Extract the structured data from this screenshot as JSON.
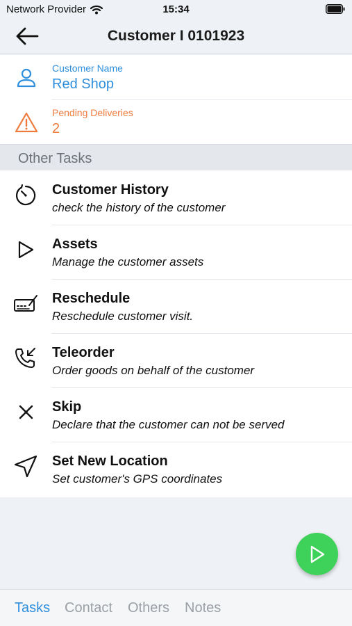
{
  "status_bar": {
    "carrier": "Network Provider",
    "time": "15:34"
  },
  "header": {
    "title": "Customer I 0101923"
  },
  "customer": {
    "name_label": "Customer Name",
    "name_value": "Red Shop",
    "deliveries_label": "Pending Deliveries",
    "deliveries_value": "2"
  },
  "section": {
    "title": "Other Tasks"
  },
  "tasks": [
    {
      "title": "Customer History",
      "subtitle": "check the history of the customer",
      "icon": "history-timer-icon"
    },
    {
      "title": "Assets",
      "subtitle": "Manage the customer assets",
      "icon": "play-outline-icon"
    },
    {
      "title": "Reschedule",
      "subtitle": "Reschedule customer visit.",
      "icon": "reschedule-signature-icon"
    },
    {
      "title": "Teleorder",
      "subtitle": "Order goods on behalf of the customer",
      "icon": "phone-incoming-icon"
    },
    {
      "title": "Skip",
      "subtitle": "Declare that the customer can not be served",
      "icon": "close-x-icon"
    },
    {
      "title": "Set New Location",
      "subtitle": "Set customer's GPS coordinates",
      "icon": "navigation-arrow-icon"
    }
  ],
  "tabs": [
    {
      "label": "Tasks",
      "active": true
    },
    {
      "label": "Contact",
      "active": false
    },
    {
      "label": "Others",
      "active": false
    },
    {
      "label": "Notes",
      "active": false
    }
  ],
  "colors": {
    "accent_blue": "#2f8fdc",
    "warning_orange": "#ee7a3d",
    "fab_green": "#3fd25a"
  }
}
